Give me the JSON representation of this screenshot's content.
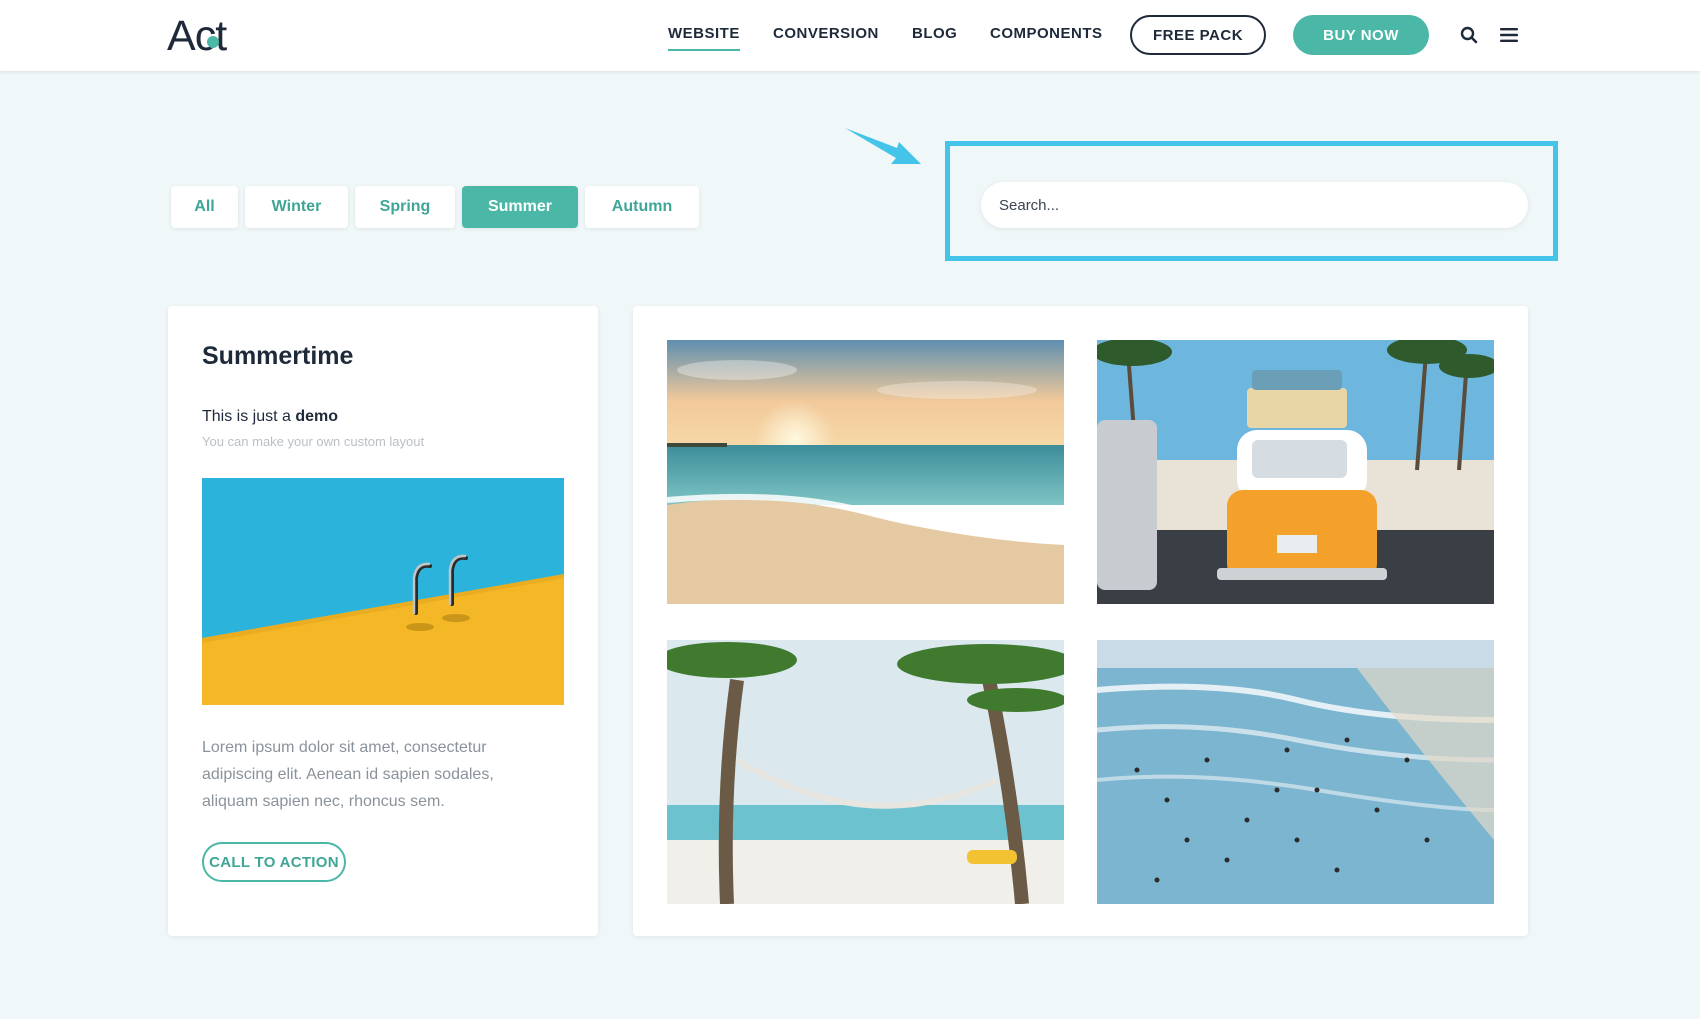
{
  "header": {
    "logo_text": "Act",
    "nav": [
      {
        "label": "WEBSITE",
        "active": true
      },
      {
        "label": "CONVERSION",
        "active": false
      },
      {
        "label": "BLOG",
        "active": false
      },
      {
        "label": "COMPONENTS",
        "active": false
      }
    ],
    "free_pack_label": "FREE PACK",
    "buy_now_label": "BUY NOW",
    "icons": [
      "search-icon",
      "hamburger-menu-icon"
    ]
  },
  "filters": [
    {
      "label": "All",
      "active": false
    },
    {
      "label": "Winter",
      "active": false
    },
    {
      "label": "Spring",
      "active": false
    },
    {
      "label": "Summer",
      "active": true
    },
    {
      "label": "Autumn",
      "active": false
    }
  ],
  "search": {
    "placeholder": "Search...",
    "value": ""
  },
  "card": {
    "title": "Summertime",
    "subtitle_prefix": "This is just a",
    "subtitle_bold": "demo",
    "note": "You can make your own custom layout",
    "body": "Lorem ipsum dolor sit amet, consectetur adipiscing elit. Aenean id sapien sodales, aliquam sapien nec, rhoncus sem.",
    "cta_label": "CALL TO ACTION"
  },
  "colors": {
    "accent": "#4bb7a7",
    "highlight": "#45c4e9",
    "page_bg": "#f0f7f8",
    "text_dark": "#1e2a3a"
  }
}
